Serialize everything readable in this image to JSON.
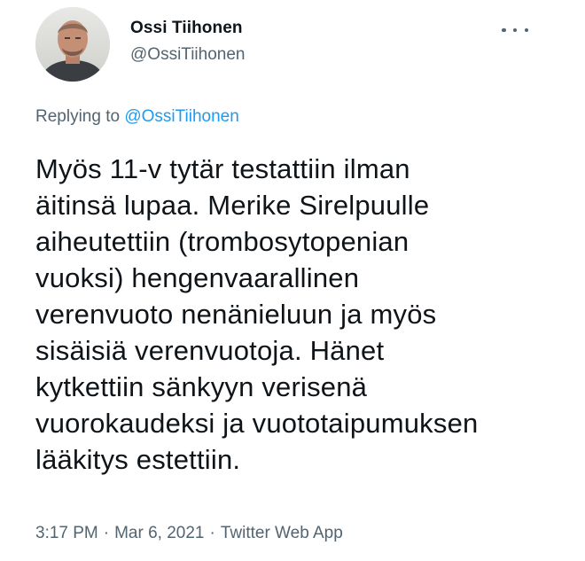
{
  "author": {
    "display_name": "Ossi Tiihonen",
    "handle": "@OssiTiihonen",
    "avatar_icon": "profile-photo"
  },
  "more_icon": "more-horizontal-icon",
  "reply": {
    "prefix": "Replying to ",
    "mention": "@OssiTiihonen"
  },
  "tweet": {
    "lines": [
      "Myös 11-v tytär testattiin ilman",
      "äitinsä lupaa. Merike Sirelpuulle",
      "aiheutettiin (trombosytopenian",
      "vuoksi) hengenvaarallinen",
      "verenvuoto nenänieluun ja myös",
      "sisäisiä verenvuotoja. Hänet",
      "kytkettiin sänkyyn verisenä",
      "vuorokaudeksi ja vuototaipumuksen",
      "lääkitys estettiin."
    ]
  },
  "meta": {
    "time": "3:17 PM",
    "separator": "·",
    "date": "Mar 6, 2021",
    "source": "Twitter Web App"
  },
  "colors": {
    "text_primary": "#0f1419",
    "text_secondary": "#536471",
    "link": "#1d9bf0",
    "background": "#ffffff"
  }
}
